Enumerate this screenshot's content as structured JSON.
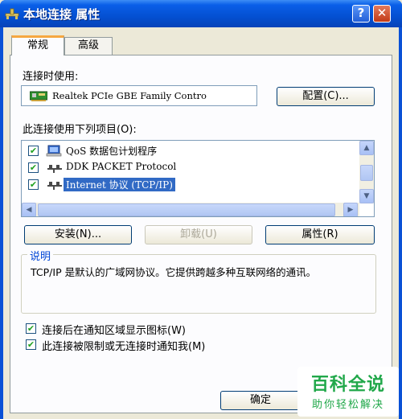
{
  "window": {
    "title": "本地连接 属性",
    "help_label": "?",
    "close_label": "✕"
  },
  "tabs": [
    {
      "label": "常规"
    },
    {
      "label": "高级"
    }
  ],
  "connect_using": {
    "label": "连接时使用:",
    "adapter": "Realtek PCIe GBE Family Contro",
    "configure_button": "配置(C)..."
  },
  "components": {
    "label": "此连接使用下列项目(O):",
    "items": [
      {
        "label": "QoS 数据包计划程序",
        "checked": true,
        "icon": "qos-scheduler-icon"
      },
      {
        "label": "DDK PACKET Protocol",
        "checked": true,
        "icon": "protocol-icon"
      },
      {
        "label": "Internet 协议 (TCP/IP)",
        "checked": true,
        "icon": "protocol-icon",
        "selected": true
      }
    ],
    "scroll_up": "▲",
    "scroll_down": "▼",
    "scroll_left": "◀",
    "scroll_right": "▶"
  },
  "actions": {
    "install": "安装(N)...",
    "uninstall": "卸载(U)",
    "properties": "属性(R)"
  },
  "description": {
    "title": "说明",
    "text": "TCP/IP 是默认的广域网协议。它提供跨越多种互联网络的通讯。"
  },
  "options": [
    {
      "label": "连接后在通知区域显示图标(W)",
      "checked": true
    },
    {
      "label": "此连接被限制或无连接时通知我(M)",
      "checked": true
    }
  ],
  "footer": {
    "ok_button": "确定"
  },
  "watermark": {
    "main": "百科全说",
    "sub": "助你轻松解决"
  },
  "colors": {
    "title_bar": "#0450d2",
    "selection": "#316ac5",
    "group_title": "#0046d5",
    "watermark": "#21a84a"
  }
}
